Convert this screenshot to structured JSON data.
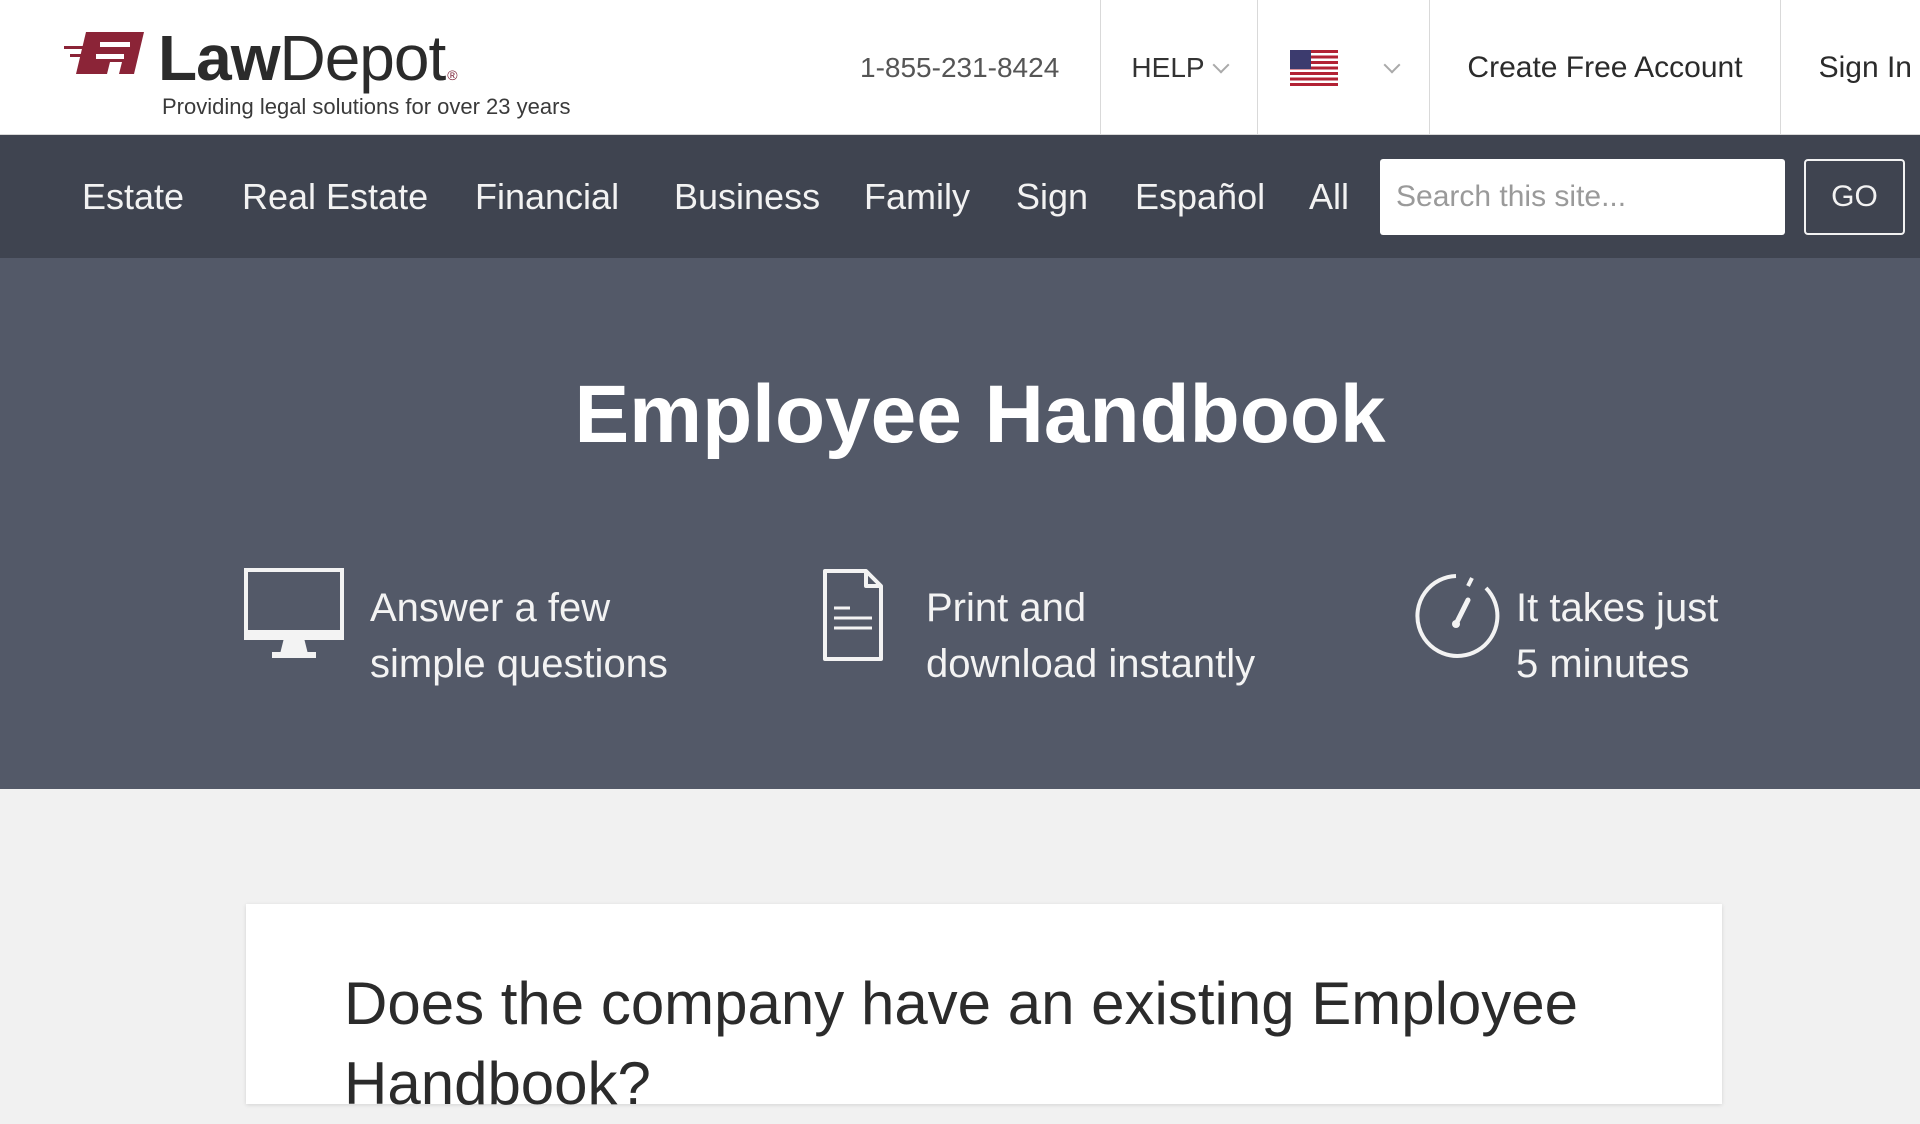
{
  "header": {
    "brand_law": "Law",
    "brand_depot": "Depot",
    "brand_reg": "®",
    "tagline": "Providing legal solutions for over 23 years",
    "phone": "1-855-231-8424",
    "help_label": "HELP",
    "country_flag": "us-flag",
    "create_account_label": "Create Free Account",
    "sign_in_label": "Sign In"
  },
  "nav": {
    "items": [
      "Estate",
      "Real Estate",
      "Financial",
      "Business",
      "Family",
      "Sign",
      "Español",
      "All"
    ],
    "search_placeholder": "Search this site...",
    "go_label": "GO"
  },
  "hero": {
    "title": "Employee Handbook",
    "features": [
      {
        "icon": "monitor-icon",
        "line1": "Answer a few",
        "line2": "simple questions"
      },
      {
        "icon": "document-icon",
        "line1": "Print and",
        "line2": "download instantly"
      },
      {
        "icon": "stopwatch-icon",
        "line1": "It takes just",
        "line2": "5 minutes"
      }
    ]
  },
  "card": {
    "question": "Does the company have an existing Employee Handbook?"
  },
  "colors": {
    "brand_accent": "#8b2437",
    "nav_bg": "#3f4450",
    "hero_bg": "#535968",
    "page_bg": "#f1f1f1"
  }
}
